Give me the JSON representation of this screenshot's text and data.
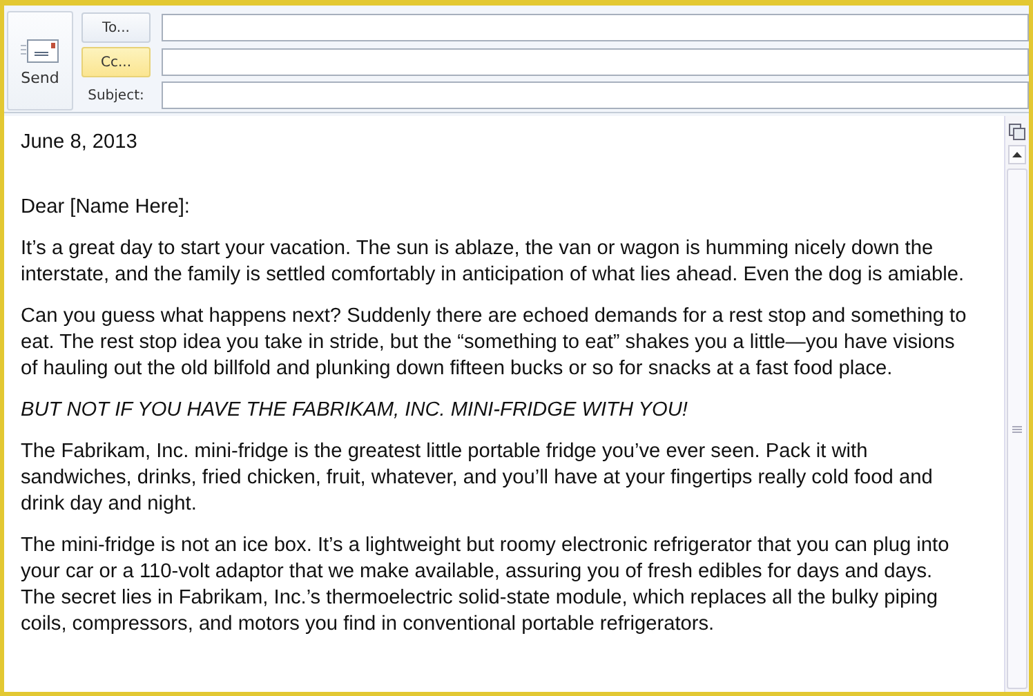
{
  "header": {
    "send_button": "Send",
    "address_buttons": [
      {
        "label": "To...",
        "selected": false
      },
      {
        "label": "Cc...",
        "selected": true
      }
    ],
    "subject_label": "Subject:"
  },
  "body": {
    "paragraphs": [
      {
        "text": "June 8, 2013",
        "italic": false
      },
      {
        "text": "Dear [Name Here]:",
        "italic": false
      },
      {
        "text": "It’s a great day to start your vacation. The sun is ablaze, the van or wagon is humming nicely down the interstate, and the family is settled comfortably in anticipation of what lies ahead. Even the dog is amiable.",
        "italic": false
      },
      {
        "text": "Can you guess what happens next? Suddenly there are echoed demands for a rest stop and something to eat. The rest stop idea you take in stride, but the “something to eat” shakes you a little—you have visions of hauling out the old billfold and plunking down fifteen bucks or so for snacks at a fast food place.",
        "italic": false
      },
      {
        "text": "BUT NOT IF YOU HAVE THE FABRIKAM, INC. MINI-FRIDGE WITH YOU!",
        "italic": true
      },
      {
        "text": "The Fabrikam, Inc. mini-fridge is the greatest little portable fridge you’ve ever seen. Pack it with sandwiches, drinks, fried chicken, fruit, whatever, and you’ll have at your fingertips really cold food and drink day and night.",
        "italic": false
      },
      {
        "text": "The mini-fridge is not an ice box. It’s a lightweight but roomy electronic refrigerator that you can plug into your car or a 110-volt adaptor that we make available, assuring you of fresh edibles for days and days. The secret lies in Fabrikam, Inc.’s thermoelectric solid-state module, which replaces all the bulky piping coils, compressors, and motors you find in conventional portable refrigerators.",
        "italic": false
      }
    ]
  }
}
